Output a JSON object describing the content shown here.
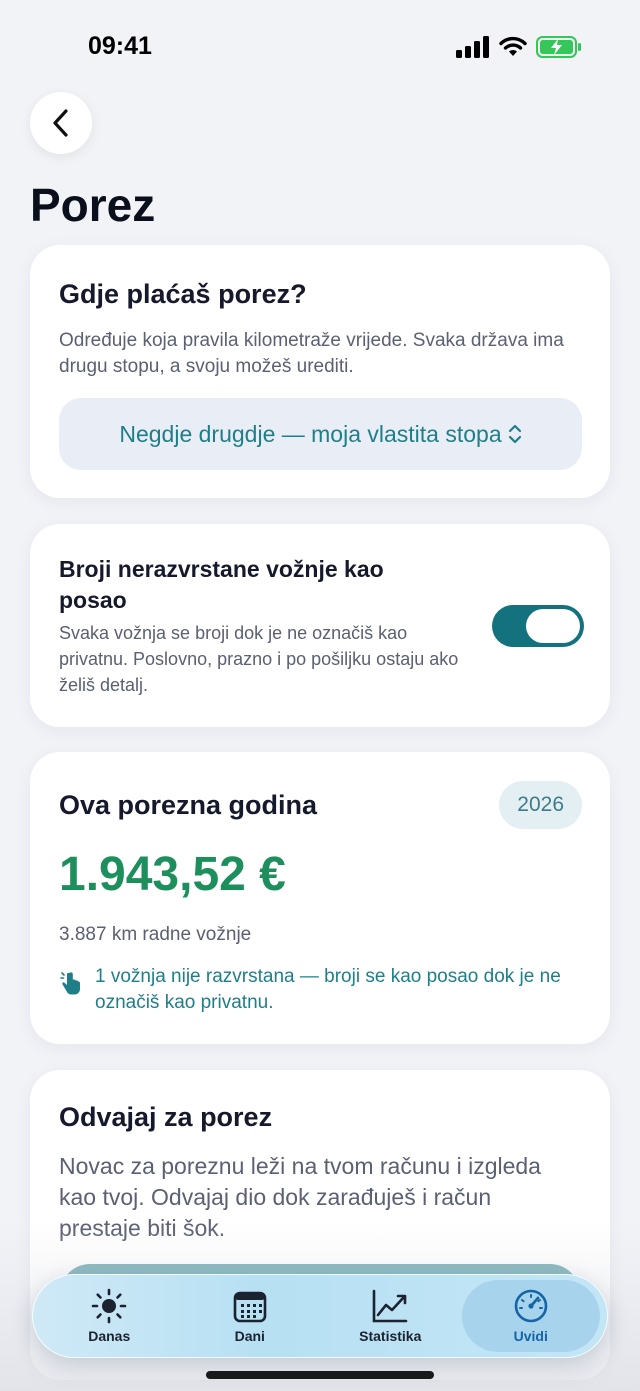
{
  "status": {
    "time": "09:41"
  },
  "page": {
    "title": "Porez"
  },
  "tax_location": {
    "heading": "Gdje plaćaš porez?",
    "description": "Određuje koja pravila kilometraže vrijede. Svaka država ima drugu stopu, a svoju možeš urediti.",
    "selected": "Negdje drugdje — moja vlastita stopa"
  },
  "unsorted_trips": {
    "heading": "Broji nerazvrstane vožnje kao posao",
    "description": "Svaka vožnja se broji dok je ne označiš kao privatnu. Poslovno, prazno i po pošiljku ostaju ako želiš detalj.",
    "enabled": true
  },
  "tax_year": {
    "heading": "Ova porezna godina",
    "year": "2026",
    "amount": "1.943,52 €",
    "km_text": "3.887 km radne vožnje",
    "note": "1 vožnja nije razvrstana — broji se kao posao dok je ne označiš kao privatnu."
  },
  "set_aside": {
    "heading": "Odvajaj za porez",
    "description": "Novac za poreznu leži na tvom računu i izgleda kao tvoj. Odvajaj dio dok zarađuješ i račun prestaje biti šok."
  },
  "tabs": [
    {
      "label": "Danas",
      "icon": "sun-icon"
    },
    {
      "label": "Dani",
      "icon": "calendar-icon"
    },
    {
      "label": "Statistika",
      "icon": "chart-icon"
    },
    {
      "label": "Uvidi",
      "icon": "gauge-icon",
      "active": true
    }
  ],
  "colors": {
    "accent": "#14727f",
    "amount": "#1d8f5d",
    "active_tab": "#1565a6"
  }
}
